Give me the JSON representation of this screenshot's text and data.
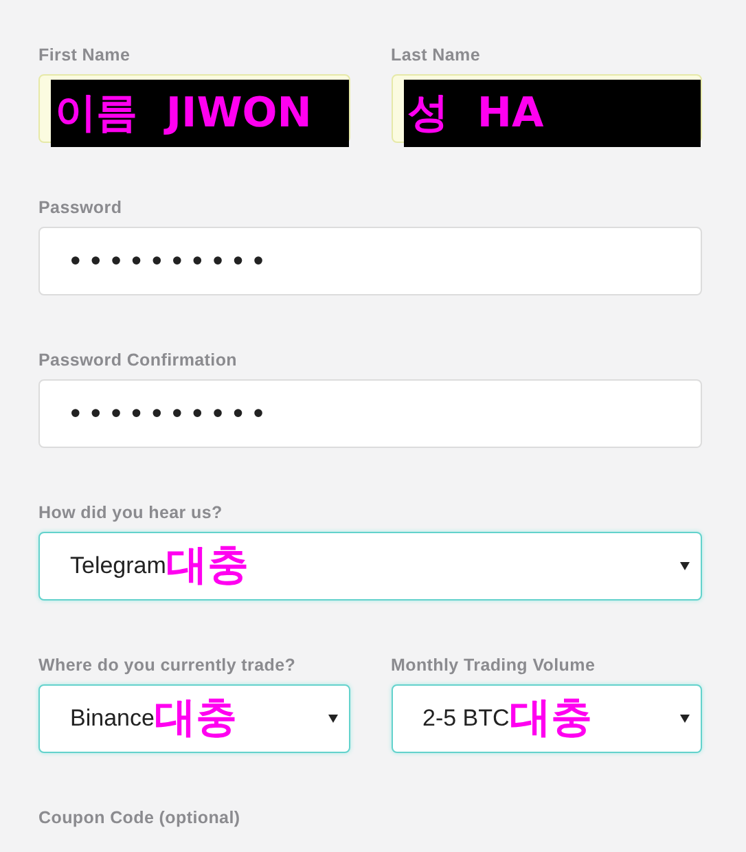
{
  "rows": [
    {
      "fields": [
        {
          "kind": "name",
          "label": "First Name",
          "value": "이름  JIWON"
        },
        {
          "kind": "name",
          "label": "Last Name",
          "value": "성  HA"
        }
      ]
    },
    {
      "fields": [
        {
          "kind": "password",
          "label": "Password",
          "value": "••••••••••"
        }
      ]
    },
    {
      "fields": [
        {
          "kind": "password",
          "label": "Password Confirmation",
          "value": "••••••••••"
        }
      ]
    },
    {
      "fields": [
        {
          "kind": "select",
          "label": "How did you hear us?",
          "value": "Telegram",
          "note": "대충"
        }
      ]
    },
    {
      "fields": [
        {
          "kind": "select",
          "label": "Where do you currently trade?",
          "value": "Binance",
          "note": "대충"
        },
        {
          "kind": "select",
          "label": "Monthly Trading Volume",
          "value": "2-5 BTC",
          "note": "대충"
        }
      ]
    },
    {
      "fields": [
        {
          "kind": "label-only",
          "label": "Coupon Code (optional)"
        }
      ]
    }
  ]
}
